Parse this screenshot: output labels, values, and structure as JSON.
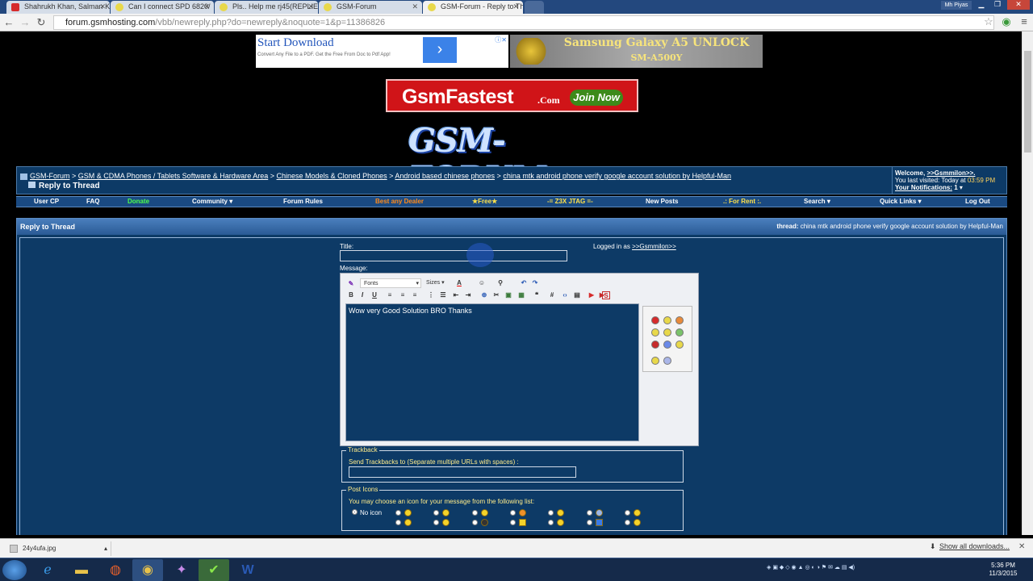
{
  "tabs": [
    {
      "label": "Shahrukh Khan, Salman K",
      "active": false
    },
    {
      "label": "Can I connect SPD 6820/",
      "active": false
    },
    {
      "label": "Pls.. Help me rj45(REPLIED",
      "active": false
    },
    {
      "label": "GSM-Forum",
      "active": false
    },
    {
      "label": "GSM-Forum - Reply to Th",
      "active": true
    }
  ],
  "user_chip": "Mh Piyas",
  "omnibox": {
    "host": "forum.gsmhosting.com",
    "path": "/vbb/newreply.php?do=newreply&noquote=1&p=11386826"
  },
  "ads": {
    "ad1_title": "Start Download",
    "ad1_sub": "Convert Any File to a PDF. Get the Free From Doc to Pdf App!",
    "ad2_line1": "Samsung Galaxy A5 UNLOCK",
    "ad2_line2": "SM-A500Y",
    "banner_main": "GsmFastest",
    "banner_com": ".Com",
    "banner_join": "Join Now"
  },
  "logo_text": "GSM-FORUM",
  "breadcrumb": {
    "items": [
      "GSM-Forum",
      "GSM & CDMA Phones / Tablets Software & Hardware Area",
      "Chinese Models & Cloned Phones",
      "Android based chinese phones",
      "china mtk android phone verify google account solution by Helpful-Man"
    ],
    "sep": ">",
    "current": "Reply to Thread"
  },
  "welcome": {
    "label": "Welcome,",
    "user": ">>Gsmmilon>>.",
    "last_visit_label": "You last visited: Today at",
    "last_visit_time": "03:59 PM",
    "notifications_label": "Your Notifications:",
    "notifications_count": "1"
  },
  "menu": [
    "User CP",
    "FAQ",
    "Donate",
    "Community",
    "Forum Rules",
    "Best any Dealer",
    "Free",
    "Z3X JTAG",
    "New Posts",
    "For Rent",
    "Search",
    "Quick Links",
    "Log Out"
  ],
  "menu_colors": {
    "Donate": "#4cff4c",
    "Best any Dealer": "#ff8a1a",
    "Free": "#ffe14a",
    "Z3X JTAG": "#ffe14a",
    "For Rent": "#ffe14a"
  },
  "reply": {
    "heading": "Reply to Thread",
    "thread_label": "thread:",
    "thread_title": "china mtk android phone verify google account solution by Helpful-Man",
    "title_label": "Title:",
    "title_value": "",
    "logged_label": "Logged in as",
    "logged_user": ">>Gsmmilon>>",
    "message_label": "Message:",
    "fonts_label": "Fonts",
    "sizes_label": "Sizes",
    "message_text": "Wow very Good Solution BRO Thanks",
    "trackback_legend": "Trackback",
    "trackback_label": "Send Trackbacks to (Separate multiple URLs with spaces) :",
    "trackback_value": "",
    "post_icons_legend": "Post Icons",
    "post_icons_label": "You may choose an icon for your message from the following list:",
    "no_icon_label": "No icon"
  },
  "downloads": {
    "file": "24y4ufa.jpg",
    "show_all": "Show all downloads..."
  },
  "clock": {
    "time": "5:36 PM",
    "date": "11/3/2015"
  }
}
